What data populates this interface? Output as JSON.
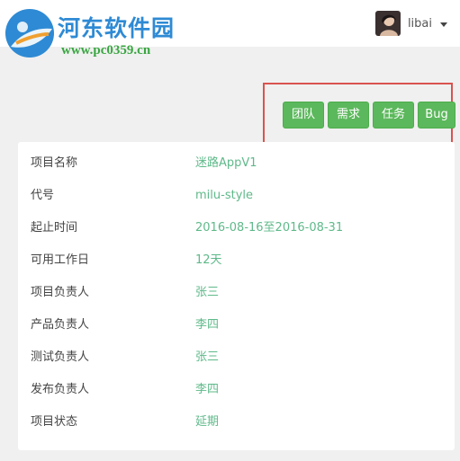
{
  "logo": {
    "title": "河东软件园",
    "url": "www.pc0359.cn"
  },
  "user": {
    "name": "libai"
  },
  "actions": {
    "team": "团队",
    "requirements": "需求",
    "tasks": "任务",
    "bug": "Bug"
  },
  "colors": {
    "button": "#5cb85c",
    "value_text": "#5fb98a",
    "highlight_border": "#d9534f",
    "logo_blue": "#2e8ad4",
    "logo_green": "#3aa642"
  },
  "project": {
    "rows": [
      {
        "label": "项目名称",
        "value": "迷路AppV1"
      },
      {
        "label": "代号",
        "value": "milu-style"
      },
      {
        "label": "起止时间",
        "value": "2016-08-16至2016-08-31"
      },
      {
        "label": "可用工作日",
        "value": "12天"
      },
      {
        "label": "项目负责人",
        "value": "张三"
      },
      {
        "label": "产品负责人",
        "value": "李四"
      },
      {
        "label": "测试负责人",
        "value": "张三"
      },
      {
        "label": "发布负责人",
        "value": "李四"
      },
      {
        "label": "项目状态",
        "value": "延期"
      }
    ]
  }
}
